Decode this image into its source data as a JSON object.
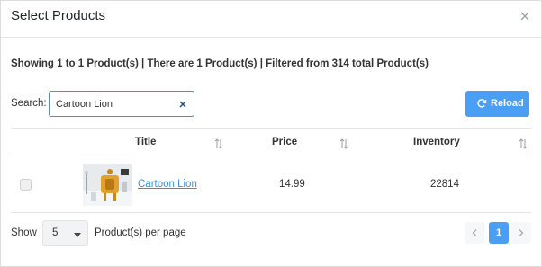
{
  "modal": {
    "title": "Select Products"
  },
  "summary": "Showing 1 to 1 Product(s) | There are 1 Product(s) | Filtered from 314 total Product(s)",
  "search": {
    "label": "Search:",
    "value": "Cartoon Lion"
  },
  "toolbar": {
    "reload_label": "Reload"
  },
  "table": {
    "columns": [
      "Title",
      "Price",
      "Inventory"
    ],
    "rows": [
      {
        "title": "Cartoon Lion",
        "price": "14.99",
        "inventory": "22814",
        "selected": false
      }
    ]
  },
  "footer": {
    "show_label": "Show",
    "page_size": "5",
    "per_page_label": "Product(s) per page"
  },
  "pagination": {
    "current_page": "1"
  },
  "colors": {
    "accent": "#4a9ff5",
    "link": "#3b8fd8"
  },
  "icons": {
    "close": "close-icon",
    "reload": "reload-icon",
    "sort": "sort-icon",
    "clear": "clear-icon",
    "caret": "chevron-down-icon"
  }
}
